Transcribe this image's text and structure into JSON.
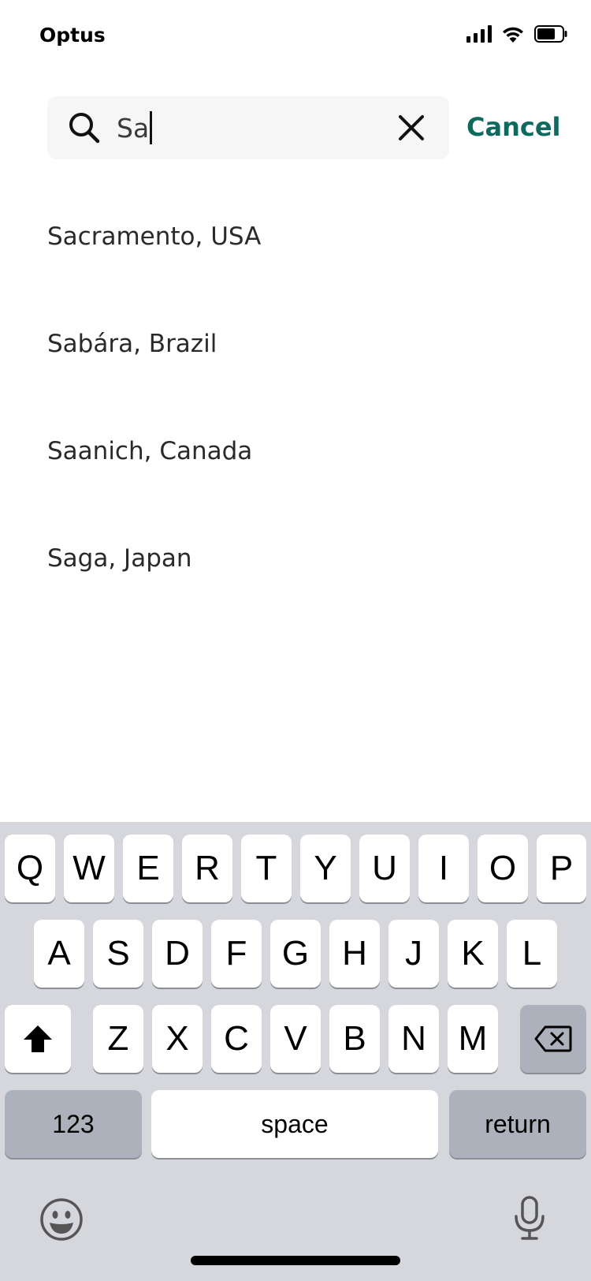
{
  "status_bar": {
    "carrier": "Optus"
  },
  "search": {
    "value": "Sa",
    "cancel_label": "Cancel"
  },
  "results": [
    "Sacramento, USA",
    "Sabára, Brazil",
    "Saanich, Canada",
    "Saga, Japan"
  ],
  "keyboard": {
    "row1": [
      "Q",
      "W",
      "E",
      "R",
      "T",
      "Y",
      "U",
      "I",
      "O",
      "P"
    ],
    "row2": [
      "A",
      "S",
      "D",
      "F",
      "G",
      "H",
      "J",
      "K",
      "L"
    ],
    "row3": [
      "Z",
      "X",
      "C",
      "V",
      "B",
      "N",
      "M"
    ],
    "numbers_label": "123",
    "space_label": "space",
    "return_label": "return"
  },
  "colors": {
    "accent": "#0e6a5d",
    "search_bg": "#f6f6f6",
    "keyboard_bg": "#d5d7dd"
  },
  "icons": {
    "search": "search-icon",
    "clear": "close-icon",
    "shift": "shift-icon",
    "backspace": "backspace-icon",
    "emoji": "emoji-icon",
    "mic": "microphone-icon"
  }
}
